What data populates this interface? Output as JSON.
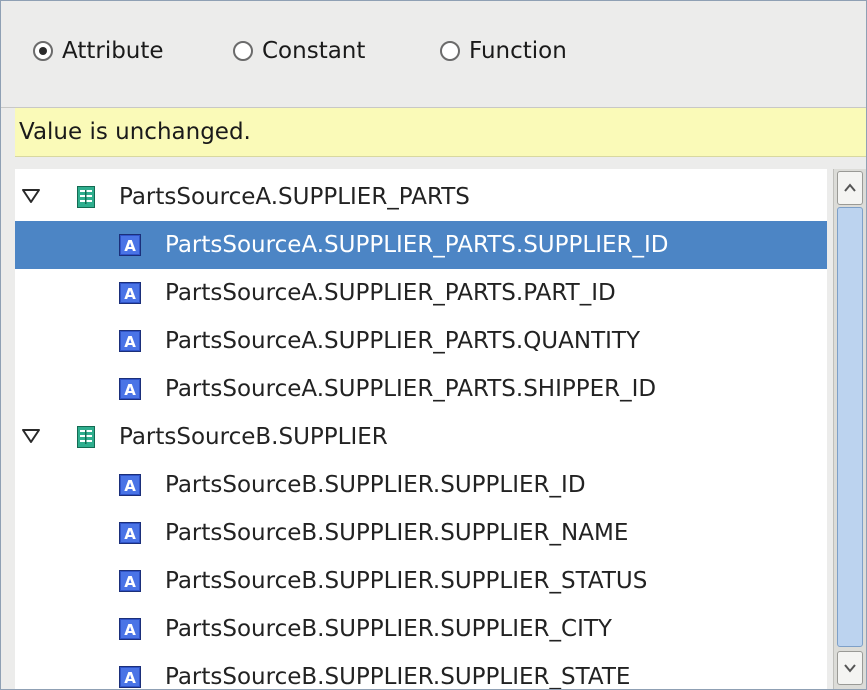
{
  "radio_options": {
    "attribute": "Attribute",
    "constant": "Constant",
    "function": "Function",
    "selected": "Attribute"
  },
  "status": {
    "message": "Value is unchanged.",
    "color": "#fafab8"
  },
  "tree": {
    "selection_color": "#4c85c5",
    "groups": [
      {
        "label": "PartsSourceA.SUPPLIER_PARTS",
        "icon": "table-icon",
        "expanded": true,
        "items": [
          {
            "label": "PartsSourceA.SUPPLIER_PARTS.SUPPLIER_ID",
            "icon": "attribute-icon",
            "selected": true
          },
          {
            "label": "PartsSourceA.SUPPLIER_PARTS.PART_ID",
            "icon": "attribute-icon"
          },
          {
            "label": "PartsSourceA.SUPPLIER_PARTS.QUANTITY",
            "icon": "attribute-icon"
          },
          {
            "label": "PartsSourceA.SUPPLIER_PARTS.SHIPPER_ID",
            "icon": "attribute-icon"
          }
        ]
      },
      {
        "label": "PartsSourceB.SUPPLIER",
        "icon": "table-icon",
        "expanded": true,
        "items": [
          {
            "label": "PartsSourceB.SUPPLIER.SUPPLIER_ID",
            "icon": "attribute-icon"
          },
          {
            "label": "PartsSourceB.SUPPLIER.SUPPLIER_NAME",
            "icon": "attribute-icon"
          },
          {
            "label": "PartsSourceB.SUPPLIER.SUPPLIER_STATUS",
            "icon": "attribute-icon"
          },
          {
            "label": "PartsSourceB.SUPPLIER.SUPPLIER_CITY",
            "icon": "attribute-icon"
          },
          {
            "label": "PartsSourceB.SUPPLIER.SUPPLIER_STATE",
            "icon": "attribute-icon"
          }
        ]
      }
    ]
  }
}
